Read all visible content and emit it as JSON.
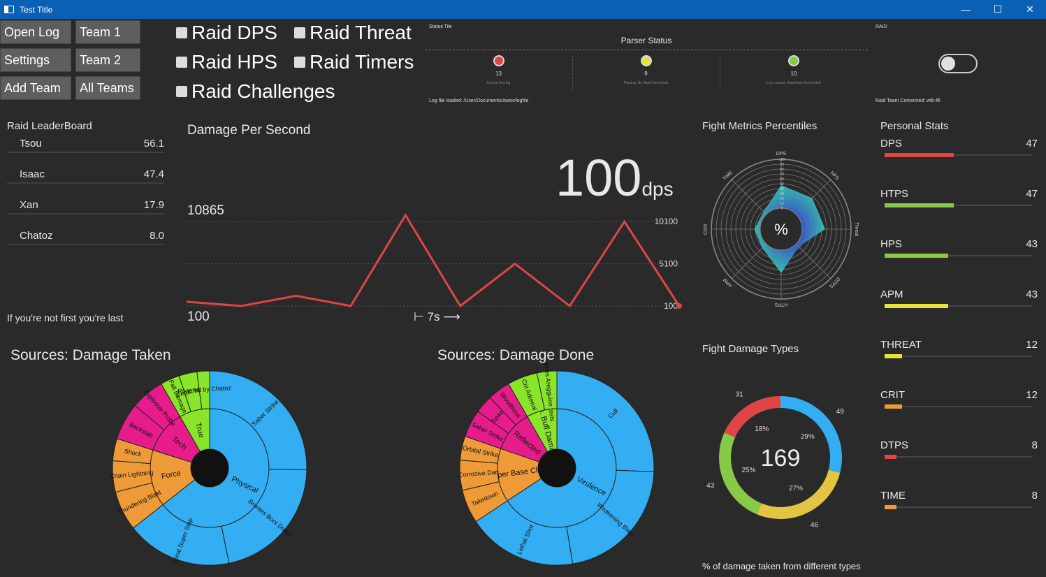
{
  "window": {
    "title": "Test Title",
    "controls": [
      "—",
      "☐",
      "✕"
    ]
  },
  "buttons": {
    "open_log": "Open Log",
    "team1": "Team 1",
    "settings": "Settings",
    "team2": "Team 2",
    "add_team": "Add Team",
    "all_teams": "All Teams"
  },
  "toggles": {
    "raid_dps": "Raid DPS",
    "raid_threat": "Raid Threat",
    "raid_hps": "Raid HPS",
    "raid_timers": "Raid Timers",
    "raid_challenges": "Raid Challenges"
  },
  "status": {
    "tile_title": "Status Tile",
    "parser_title": "Parser Status",
    "lights": [
      {
        "count": "13",
        "caption": "Cannot find log",
        "color": "#e04545"
      },
      {
        "count": "9",
        "caption": "Parsing, No Raid Connected",
        "color": "#e4e43a"
      },
      {
        "count": "10",
        "caption": "Log Loaded, Raid team Connected",
        "color": "#88c948"
      }
    ],
    "log_file": "Log file loaded: /User/Documents/swtor/logfile"
  },
  "raid_panel": {
    "title": "RAID",
    "toggle_on": false,
    "connected": "Raid Team Connected: wtb-fill"
  },
  "leaderboard": {
    "title": "Raid LeaderBoard",
    "rows": [
      {
        "name": "Tsou",
        "value": "56.1"
      },
      {
        "name": "Isaac",
        "value": "47.4"
      },
      {
        "name": "Xan",
        "value": "17.9"
      },
      {
        "name": "Chatoz",
        "value": "8.0"
      }
    ],
    "footer": "If you're not first you're last"
  },
  "dps": {
    "title": "Damage Per Second",
    "current_value": "100",
    "current_unit": "dps",
    "max_label": "10865",
    "min_label": "100",
    "time_span": "⊢ 7s ⟶",
    "tick_labels": [
      "10100",
      "5100",
      "100"
    ]
  },
  "chart_data": [
    {
      "type": "line",
      "title": "Damage Per Second",
      "y": [
        600,
        100,
        1300,
        100,
        10865,
        100,
        5100,
        100,
        10100,
        100
      ],
      "ylim": [
        100,
        10865
      ],
      "yticks": [
        100,
        5100,
        10100
      ],
      "color": "#e04545"
    },
    {
      "type": "radar",
      "title": "Fight Metrics Percentiles",
      "axes": [
        "DPS",
        "HPS",
        "Threat",
        "DTPS",
        "HTPS",
        "APM",
        "CRIT",
        "TIME"
      ],
      "values": [
        47,
        47,
        47,
        8,
        47,
        12,
        12,
        8
      ],
      "rlim": [
        0,
        100
      ],
      "ticks": [
        0,
        10,
        20,
        30,
        40,
        50,
        60,
        70,
        80,
        90,
        100
      ],
      "center_label": "%"
    },
    {
      "type": "pie",
      "title": "Fight Damage Types",
      "center_label": "169",
      "values": [
        49,
        46,
        43,
        31
      ],
      "percent_labels": [
        "29%",
        "27%",
        "25%",
        "18%"
      ],
      "colors": [
        "#33aef2",
        "#e4c443",
        "#88c948",
        "#e04545"
      ],
      "footer": "% of damage taken from different types"
    },
    {
      "type": "sunburst",
      "title": "Sources: Damage Taken",
      "inner": [
        {
          "name": "Physical",
          "value": 64.4,
          "color": "#33aef2"
        },
        {
          "name": "Force",
          "value": 15.5,
          "color": "#ee9a38"
        },
        {
          "name": "Tech",
          "value": 11.8,
          "color": "#e71c8c"
        },
        {
          "name": "True",
          "value": 8.3,
          "color": "#88e52a"
        }
      ],
      "outer": [
        {
          "name": "Saber Strike",
          "value": 25.3,
          "color": "#33aef2"
        },
        {
          "name": "Brontes Boot Down",
          "value": 21.5,
          "color": "#33aef2"
        },
        {
          "name": "Spiral Super Slap",
          "value": 17.6,
          "color": "#33aef2"
        },
        {
          "name": "Thundering Blast",
          "value": 6.6,
          "color": "#ee9a38"
        },
        {
          "name": "Chain Lightning",
          "value": 5.2,
          "color": "#ee9a38"
        },
        {
          "name": "Shock",
          "value": 3.7,
          "color": "#ee9a38"
        },
        {
          "name": "Backstab",
          "value": 6.2,
          "color": "#e71c8c"
        },
        {
          "name": "Explosive Probe",
          "value": 5.6,
          "color": "#e71c8c"
        },
        {
          "name": "Fall Damage",
          "value": 3.2,
          "color": "#88e52a"
        },
        {
          "name": "Death Mark",
          "value": 3.0,
          "color": "#88e52a"
        },
        {
          "name": "Roasted by Chatoz",
          "value": 2.1,
          "color": "#88e52a"
        }
      ]
    },
    {
      "type": "sunburst",
      "title": "Sources: Damage Done",
      "inner": [
        {
          "name": "Virulence",
          "value": 65.7,
          "color": "#33aef2"
        },
        {
          "name": "Sniper Base Class",
          "value": 14.6,
          "color": "#ee9a38"
        },
        {
          "name": "Reflected",
          "value": 11.4,
          "color": "#e71c8c"
        },
        {
          "name": "Mis. Buff Damage",
          "value": 8.3,
          "color": "#88e52a"
        }
      ],
      "outer": [
        {
          "name": "Cull",
          "value": 25.6,
          "color": "#33aef2"
        },
        {
          "name": "Weakening Blast",
          "value": 21.8,
          "color": "#33aef2"
        },
        {
          "name": "Lethal Shot",
          "value": 18.3,
          "color": "#33aef2"
        },
        {
          "name": "Takedown",
          "value": 5.6,
          "color": "#ee9a38"
        },
        {
          "name": "Corrosive Dart",
          "value": 5.0,
          "color": "#ee9a38"
        },
        {
          "name": "Orbital Strike",
          "value": 4.0,
          "color": "#ee9a38"
        },
        {
          "name": "Saber Strike",
          "value": 4.6,
          "color": "#e71c8c"
        },
        {
          "name": "Spike",
          "value": 3.0,
          "color": "#e71c8c"
        },
        {
          "name": "Bloodthirst",
          "value": 3.8,
          "color": "#e71c8c"
        },
        {
          "name": "Crit Adrenal",
          "value": 5.0,
          "color": "#88e52a"
        },
        {
          "name": "Kenes Aregguine tests",
          "value": 3.3,
          "color": "#88e52a"
        }
      ]
    }
  ],
  "radar_title": "Fight Metrics Percentiles",
  "pie_title": "Fight Damage Types",
  "pie_footer": "% of damage taken from different types",
  "taken_title": "Sources: Damage Taken",
  "done_title": "Sources: Damage Done",
  "personal_stats": {
    "title": "Personal Stats",
    "rows": [
      {
        "label": "DPS",
        "value": "47",
        "fraction": 0.47,
        "color": "#e04545"
      },
      {
        "label": "HTPS",
        "value": "47",
        "fraction": 0.47,
        "color": "#88c948"
      },
      {
        "label": "HPS",
        "value": "43",
        "fraction": 0.43,
        "color": "#88c948"
      },
      {
        "label": "APM",
        "value": "43",
        "fraction": 0.43,
        "color": "#e4e43a"
      },
      {
        "label": "THREAT",
        "value": "12",
        "fraction": 0.12,
        "color": "#e4e43a"
      },
      {
        "label": "CRIT",
        "value": "12",
        "fraction": 0.12,
        "color": "#ee9a38"
      },
      {
        "label": "DTPS",
        "value": "8",
        "fraction": 0.08,
        "color": "#e04545"
      },
      {
        "label": "TIME",
        "value": "8",
        "fraction": 0.08,
        "color": "#ee9a38"
      }
    ]
  }
}
